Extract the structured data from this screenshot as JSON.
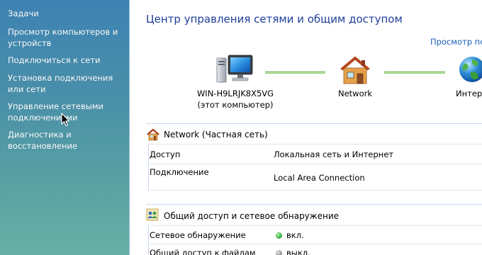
{
  "sidebar": {
    "items": [
      {
        "label": "Задачи"
      },
      {
        "label": "Просмотр компьютеров и устройств"
      },
      {
        "label": "Подключиться к сети"
      },
      {
        "label": "Установка подключения или сети"
      },
      {
        "label": "Управление сетевыми подключениями"
      },
      {
        "label": "Диагностика и восстановление"
      }
    ]
  },
  "header": {
    "title": "Центр управления сетями и общим доступом",
    "view_link": "Просмотр по"
  },
  "map": {
    "computer_name": "WIN-H9LRJK8X5VG",
    "computer_note": "(этот компьютер)",
    "network_label": "Network",
    "internet_label": "Интер"
  },
  "network_section": {
    "title": "Network (Частная сеть)",
    "rows": [
      {
        "label": "Доступ",
        "value": "Локальная сеть и Интернет"
      },
      {
        "label": "Подключение",
        "value": "Local Area Connection"
      }
    ]
  },
  "sharing_section": {
    "title": "Общий доступ и сетевое обнаружение",
    "rows": [
      {
        "label": "Сетевое обнаружение",
        "value": "вкл.",
        "status_color": "#3bb34a"
      },
      {
        "label": "Общий доступ к файлам",
        "value": "выкл.",
        "status_color": "#9a9a9a"
      }
    ]
  },
  "colors": {
    "title": "#1e3f9a",
    "link": "#1b5eb9",
    "sidebar_top": "#3d82b3",
    "sidebar_bottom": "#67b0a6",
    "connector": "#5ca43a"
  }
}
